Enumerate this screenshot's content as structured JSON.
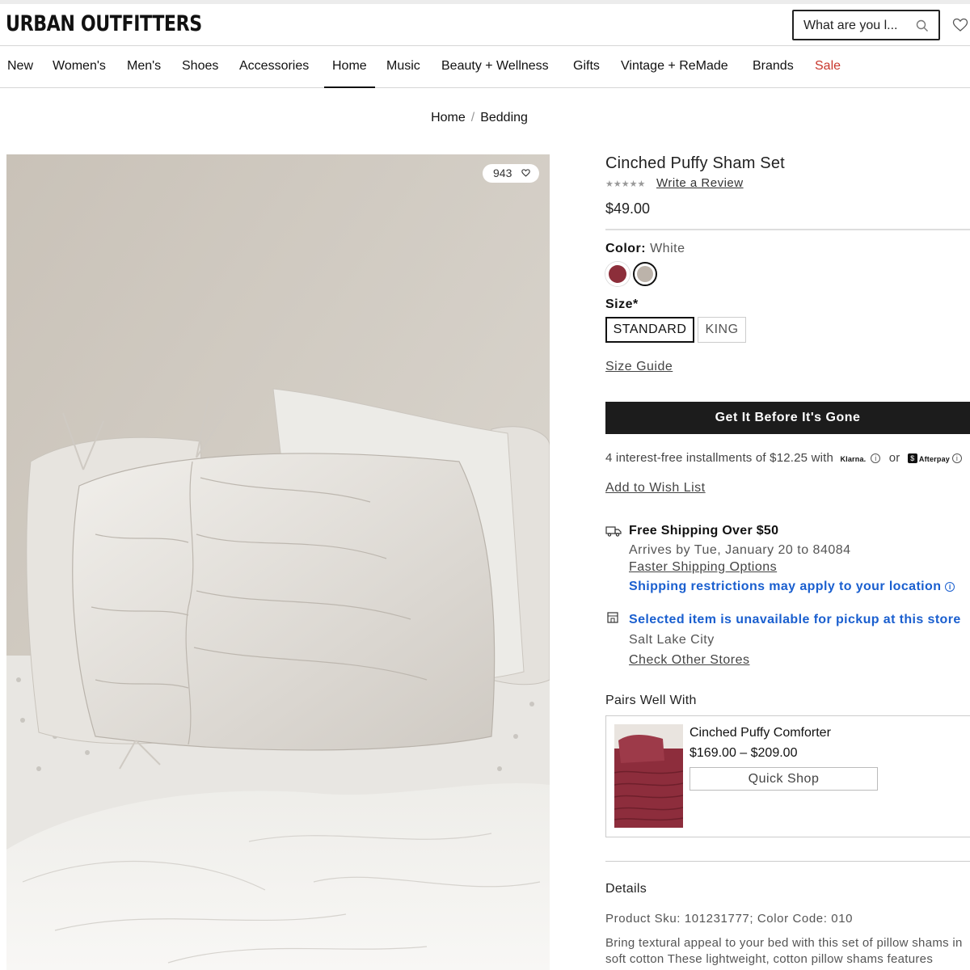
{
  "header": {
    "logo": "URBAN OUTFITTERS",
    "search_placeholder": "What are you l..."
  },
  "nav": {
    "items": [
      "New",
      "Women's",
      "Men's",
      "Shoes",
      "Accessories",
      "Home",
      "Music",
      "Beauty + Wellness",
      "Gifts",
      "Vintage + ReMade",
      "Brands",
      "Sale"
    ],
    "active": "Home"
  },
  "breadcrumb": {
    "items": [
      "Home",
      "Bedding"
    ],
    "separator": "/"
  },
  "gallery": {
    "like_count": "943"
  },
  "product": {
    "title": "Cinched Puffy Sham Set",
    "stars": "★★★★★",
    "rating_stars": 0,
    "write_review": "Write a Review",
    "price": "$49.00",
    "color_label": "Color:",
    "color_value": "White",
    "colors": [
      "#8c2e3a",
      "#bcb3aa"
    ],
    "size_label": "Size*",
    "sizes": [
      "STANDARD",
      "KING"
    ],
    "selected_size": "STANDARD",
    "size_guide": "Size Guide",
    "cta": "Get It Before It's Gone",
    "installments_text": "4 interest-free installments of $12.25 with",
    "klarna": "Klarna.",
    "or": "or",
    "afterpay": "Afterpay",
    "wishlist": "Add to Wish List"
  },
  "shipping": {
    "title": "Free Shipping Over $50",
    "arrives": "Arrives by Tue, January 20 to 84084",
    "faster": "Faster Shipping Options",
    "restrictions": "Shipping restrictions may apply to your location",
    "pickup": "Selected item is unavailable for pickup at this store",
    "city": "Salt Lake City",
    "check_stores": "Check Other Stores"
  },
  "pairs": {
    "title": "Pairs Well With",
    "name": "Cinched Puffy Comforter",
    "price": "$169.00 – $209.00",
    "quick_shop": "Quick Shop"
  },
  "details": {
    "title": "Details",
    "sku": "Product Sku: 101231777; Color Code: 010",
    "desc_line1": "Bring textural appeal to your bed with this set of pillow shams in",
    "desc_line2": "soft cotton These lightweight, cotton pillow shams features"
  },
  "colors": {
    "accent_dark": "#1c1c1c",
    "sale": "#c8372d",
    "link_blue": "#1a5fcf"
  }
}
